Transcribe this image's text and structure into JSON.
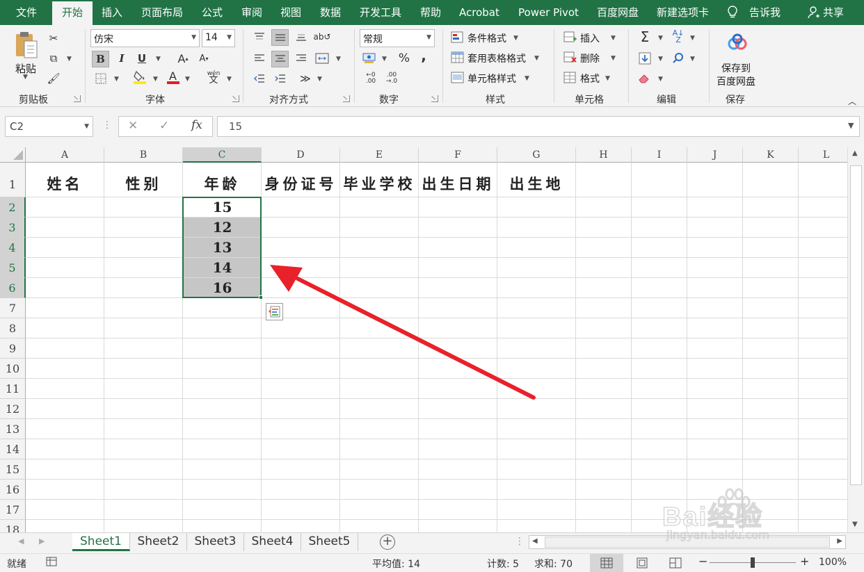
{
  "ribbon_tabs": [
    "文件",
    "开始",
    "插入",
    "页面布局",
    "公式",
    "审阅",
    "视图",
    "数据",
    "开发工具",
    "帮助",
    "Acrobat",
    "Power Pivot",
    "百度网盘",
    "新建选项卡"
  ],
  "active_tab": "开始",
  "tell_me": "告诉我",
  "share": "共享",
  "clipboard": {
    "paste": "粘贴",
    "group": "剪贴板"
  },
  "font": {
    "name": "仿宋",
    "size": "14",
    "group": "字体",
    "bold": "B",
    "italic": "I",
    "underline": "U",
    "phonetic": "wén"
  },
  "alignment": {
    "group": "对齐方式"
  },
  "number": {
    "format": "常规",
    "group": "数字",
    "percent": "%",
    "comma": ","
  },
  "styles": {
    "conditional": "条件格式",
    "table": "套用表格格式",
    "cell": "单元格样式",
    "group": "样式"
  },
  "cells": {
    "insert": "插入",
    "delete": "删除",
    "format": "格式",
    "group": "单元格"
  },
  "editing": {
    "group": "编辑"
  },
  "save": {
    "line1": "保存到",
    "line2": "百度网盘",
    "group": "保存"
  },
  "formula_bar": {
    "name_box": "C2",
    "cancel": "✕",
    "enter": "✓",
    "fx": "fx",
    "value": "15"
  },
  "columns": [
    "A",
    "B",
    "C",
    "D",
    "E",
    "F",
    "G",
    "H",
    "I",
    "J",
    "K",
    "L"
  ],
  "selected_column": "C",
  "rows": [
    "1",
    "2",
    "3",
    "4",
    "5",
    "6",
    "7",
    "8",
    "9",
    "10",
    "11",
    "12",
    "13",
    "14",
    "15",
    "16",
    "17",
    "18"
  ],
  "header_row": [
    "姓名",
    "性别",
    "年龄",
    "身份证号",
    "毕业学校",
    "出生日期",
    "出生地"
  ],
  "age_values": [
    "15",
    "12",
    "13",
    "14",
    "16"
  ],
  "sheets": [
    "Sheet1",
    "Sheet2",
    "Sheet3",
    "Sheet4",
    "Sheet5"
  ],
  "active_sheet": "Sheet1",
  "status": {
    "mode": "就绪",
    "average": "平均值: 14",
    "count": "计数: 5",
    "sum": "求和: 70",
    "zoom": "100%"
  },
  "watermark": {
    "brand": "Bai经验",
    "url": "jingyan.baidu.com"
  },
  "colors": {
    "excel_green": "#217346",
    "selection_fill": "#c6c6c6",
    "arrow_red": "#e8212b"
  }
}
